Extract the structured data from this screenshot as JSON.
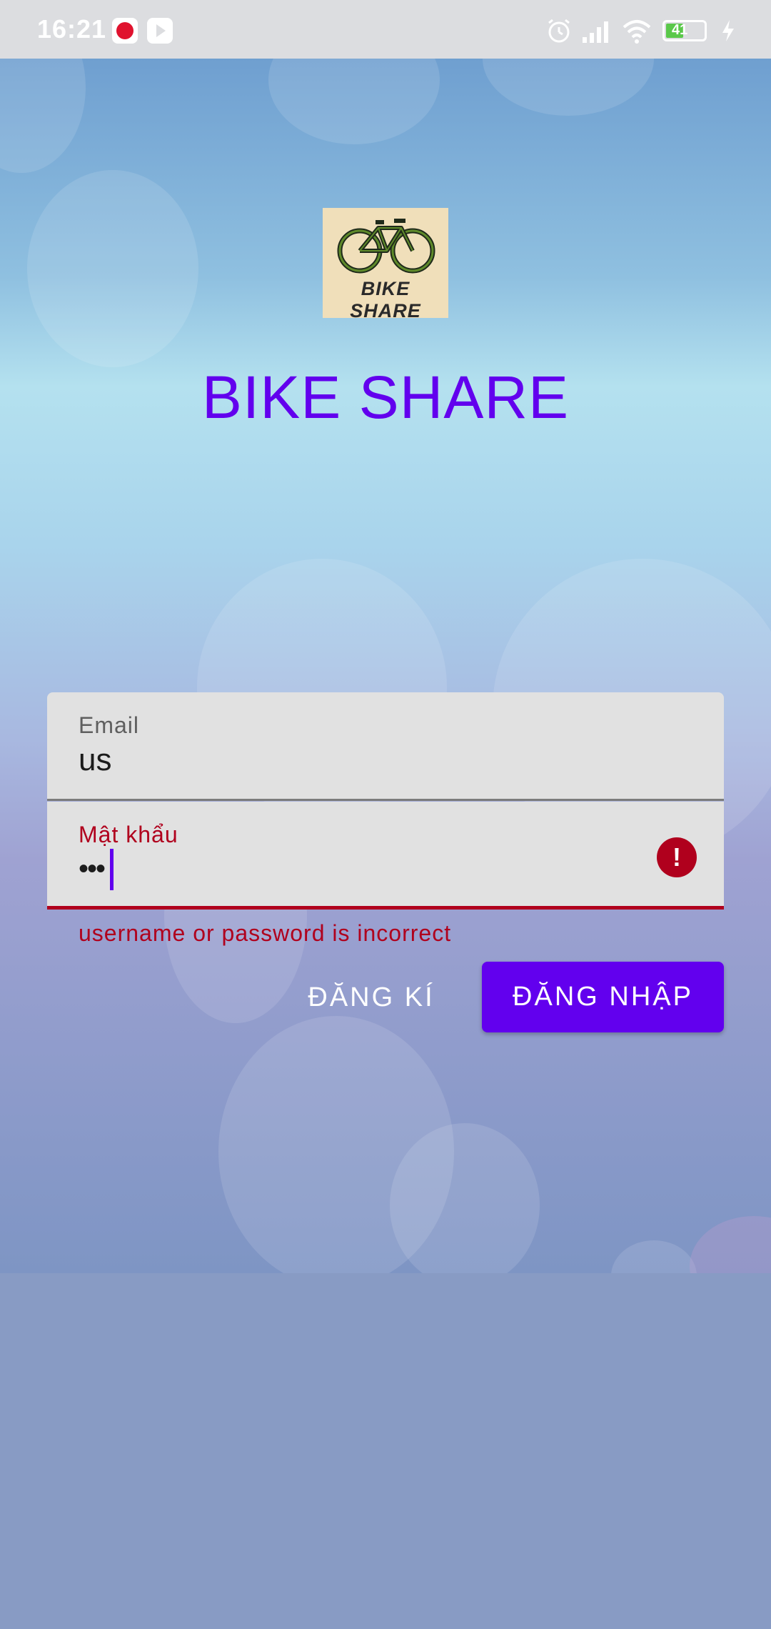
{
  "status_bar": {
    "time": "16:21",
    "battery": "41",
    "icons": [
      "notification-icon",
      "play-icon",
      "alarm-icon",
      "signal-icon",
      "wifi-icon",
      "battery-icon",
      "charging-icon"
    ]
  },
  "app": {
    "logo_text": "BIKE SHARE",
    "title": "BIKE SHARE"
  },
  "form": {
    "email": {
      "label": "Email",
      "value": "us"
    },
    "password": {
      "label": "Mật khẩu",
      "value": "•••",
      "error_icon": "!",
      "error_message": "username or password is incorrect"
    }
  },
  "actions": {
    "register_label": "ĐĂNG KÍ",
    "login_label": "ĐĂNG NHẬP"
  },
  "colors": {
    "primary": "#6200ee",
    "error": "#b0001d",
    "field_background": "#e1e1e1"
  }
}
